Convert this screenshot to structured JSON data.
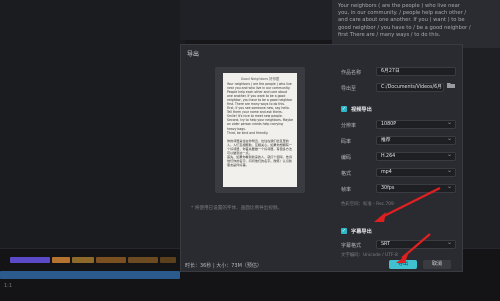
{
  "background": {
    "right_text_lines": [
      "Your neighbors ( are the people ) who live near",
      "you, in our community. / people help each other /",
      "and care about one another. If you ( want ) to be",
      "good neighbor / you have to / be a good neighbor /",
      "first There are / many ways / to do this."
    ],
    "bottom_label": "1:1"
  },
  "dialog": {
    "title": "导出",
    "preview": {
      "page_title": "Good Neighbors 好邻居",
      "page_text": "Your neighbors ( are the people ) who live near you and who live in our community. People help each other and care about one another. If you want to be a good neighbor, you have to be a good neighbor first. There are many ways to do this.\n  First, if you see someone new, say hello. Tell them your name and ask theirs. Smile! It's nice to meet new people.\n  Second, try to help your neighbors. Maybe an older person needs help carrying heavy bags.\n  Third, be kind and friendly.\n\n  你的邻居是住在你附近、也住在我们社区里的人。人们互相帮助、互相关心。如果你想拥有一个好邻居，你首先要做一个好邻居。有很多方法可以做到这一点。\n  首先，如果你看到新来的人，就打个招呼。告诉他们你的名字，问问他们的名字。微笑！认识新朋友是件好事。"
    },
    "hint": "* 将使用已设置的字体、画面比例导出视频。",
    "fields": {
      "name_label": "作品名称",
      "name_value": "6月27日",
      "path_label": "导出至",
      "path_value": "C:/Documents/Videos/6月",
      "video_section": "视频导出",
      "resolution_label": "分辨率",
      "resolution_value": "1080P",
      "bitrate_label": "码率",
      "bitrate_value": "推荐",
      "codec_label": "编码",
      "codec_value": "H.264",
      "format_label": "格式",
      "format_value": "mp4",
      "fps_label": "帧率",
      "fps_value": "30fps",
      "video_note": "色彩空间：标准 - Rec.709",
      "subtitle_section": "字幕导出",
      "subtitle_format_label": "字幕格式",
      "subtitle_format_value": "SRT",
      "encoding_note": "文字编码：Unicode / UTF-8"
    },
    "footer": {
      "info": "时长：36秒 | 大小：73M（预估）",
      "export": "导出",
      "cancel": "取消"
    }
  },
  "colors": {
    "accent": "#3fc1d0",
    "arrow": "#e02020",
    "dialog_bg": "#2a2b30"
  },
  "icons": [
    "folder-icon",
    "check-icon",
    "film-icon",
    "arrow-annotation"
  ]
}
